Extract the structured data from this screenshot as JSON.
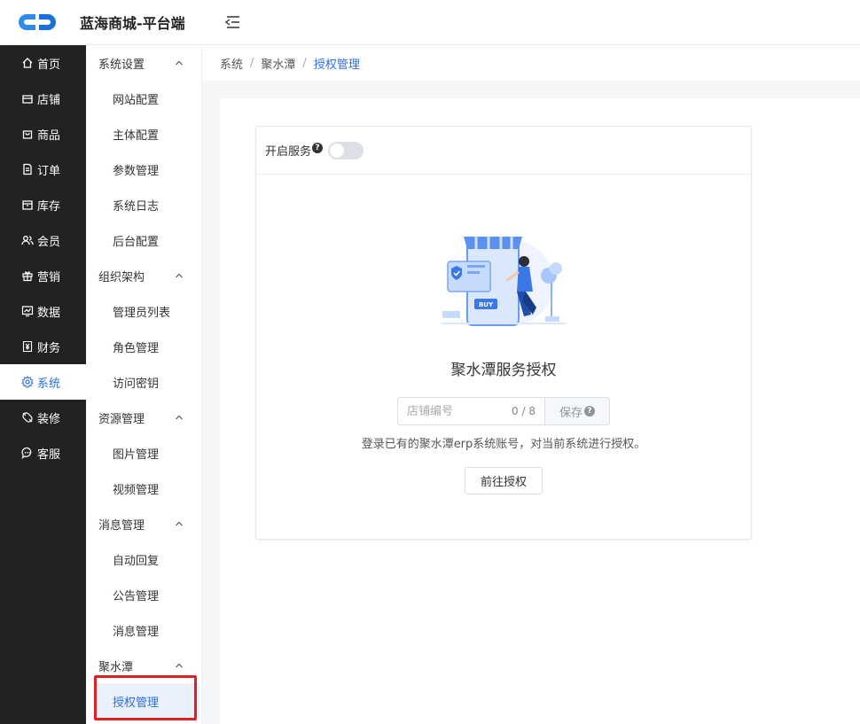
{
  "header": {
    "app_title": "蓝海商城-平台端",
    "logo_icon": "brand-logo",
    "menu_toggle_icon": "menu-fold-icon"
  },
  "primary_nav": [
    {
      "label": "首页",
      "icon": "home-icon"
    },
    {
      "label": "店铺",
      "icon": "store-icon"
    },
    {
      "label": "商品",
      "icon": "bag-icon"
    },
    {
      "label": "订单",
      "icon": "document-icon"
    },
    {
      "label": "库存",
      "icon": "box-icon"
    },
    {
      "label": "会员",
      "icon": "users-icon"
    },
    {
      "label": "营销",
      "icon": "gift-icon"
    },
    {
      "label": "数据",
      "icon": "chart-icon"
    },
    {
      "label": "财务",
      "icon": "yen-icon"
    },
    {
      "label": "系统",
      "icon": "gear-icon",
      "active": true
    },
    {
      "label": "装修",
      "icon": "brush-icon"
    },
    {
      "label": "客服",
      "icon": "chat-icon"
    }
  ],
  "secondary_nav": [
    {
      "title": "系统设置",
      "items": [
        "网站配置",
        "主体配置",
        "参数管理",
        "系统日志",
        "后台配置"
      ]
    },
    {
      "title": "组织架构",
      "items": [
        "管理员列表",
        "角色管理",
        "访问密钥"
      ]
    },
    {
      "title": "资源管理",
      "items": [
        "图片管理",
        "视频管理"
      ]
    },
    {
      "title": "消息管理",
      "items": [
        "自动回复",
        "公告管理",
        "消息管理"
      ]
    },
    {
      "title": "聚水潭",
      "items": [
        "授权管理"
      ]
    }
  ],
  "active_item": "授权管理",
  "breadcrumb": [
    "系统",
    "聚水潭",
    "授权管理"
  ],
  "card": {
    "service_label": "开启服务",
    "service_enabled": false,
    "title": "聚水潭服务授权",
    "input_placeholder": "店铺编号",
    "input_value": "",
    "char_count": "0 / 8",
    "save_label": "保存",
    "description": "登录已有的聚水潭erp系统账号，对当前系统进行授权。",
    "go_button_label": "前往授权",
    "help_symbol": "?"
  },
  "colors": {
    "accent": "#2d6ee5",
    "sidebar_bg": "#222222",
    "highlight_border": "#e02020"
  }
}
